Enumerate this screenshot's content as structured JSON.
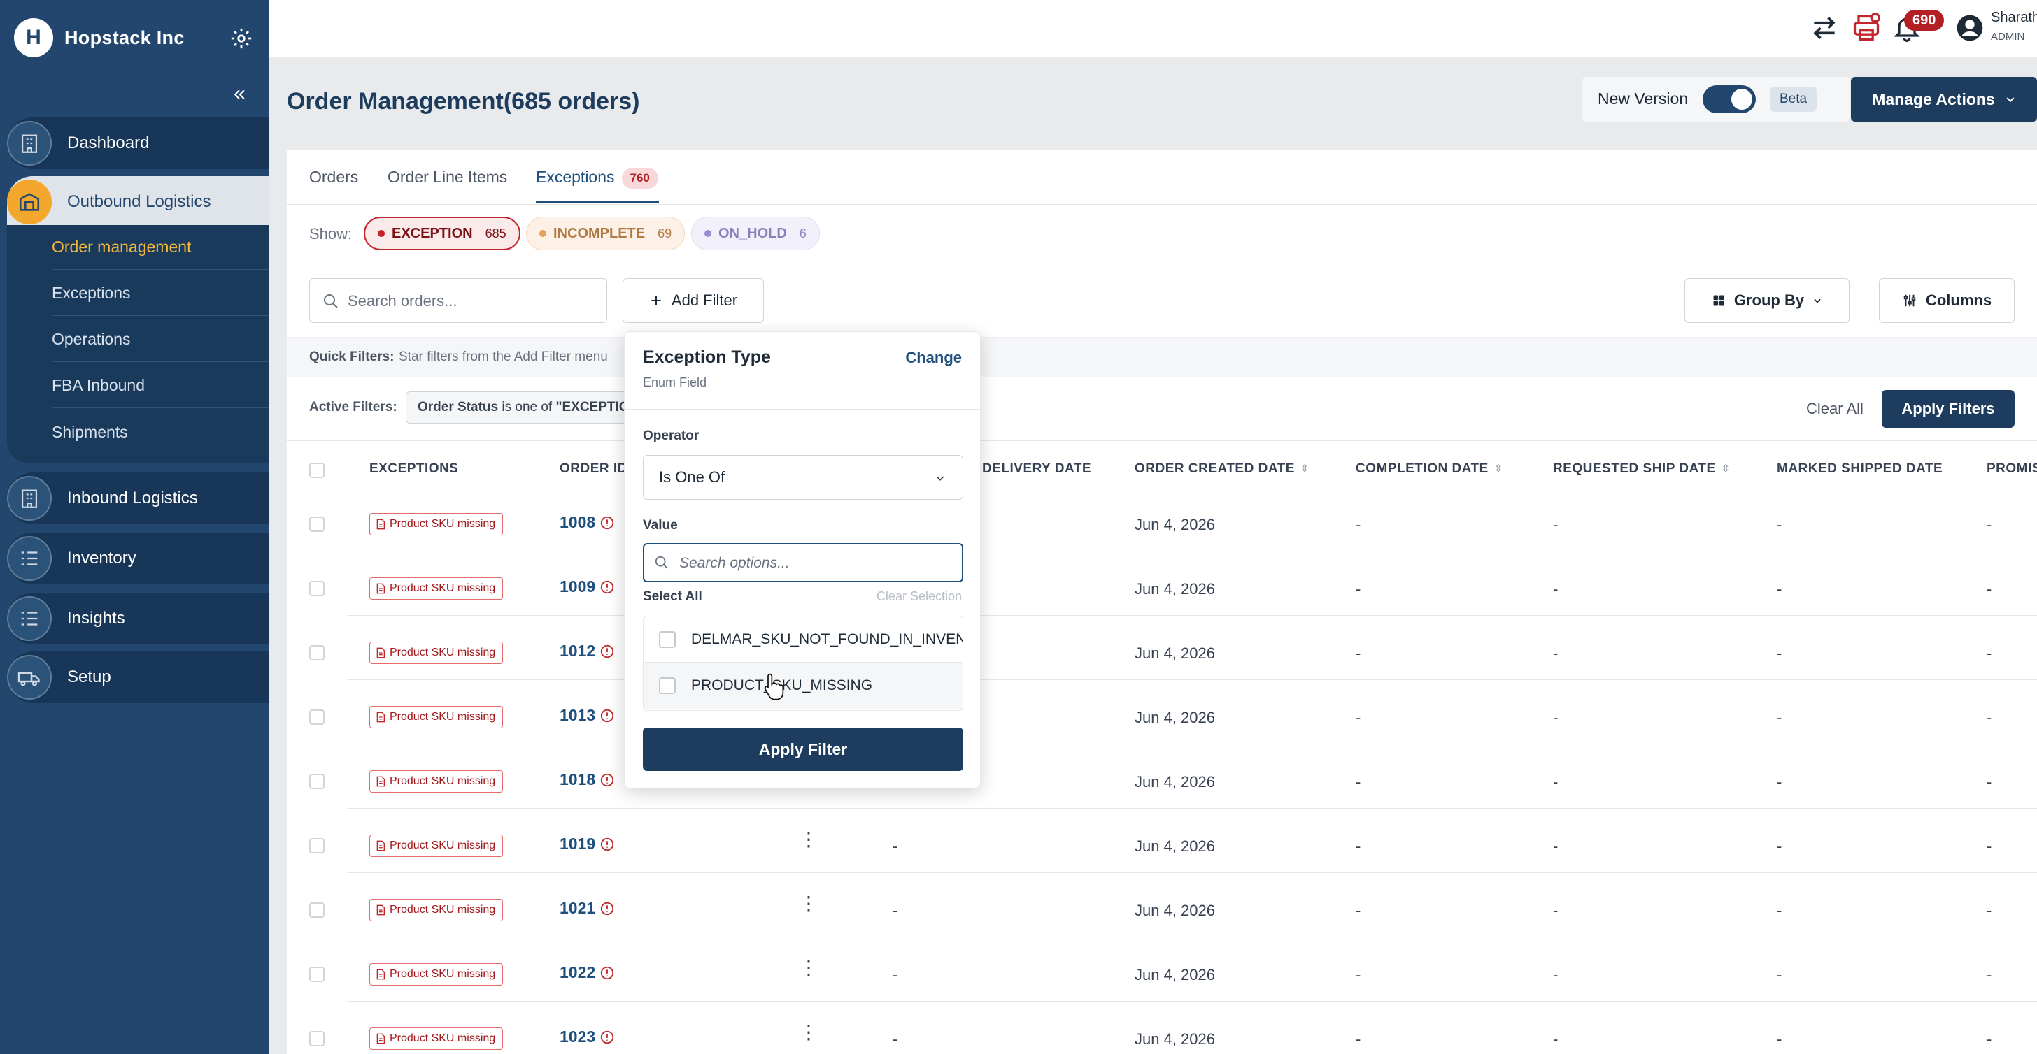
{
  "brand": {
    "name": "Hopstack Inc",
    "logo_letter": "H"
  },
  "sidebar": {
    "items": [
      {
        "label": "Dashboard",
        "icon": "building-icon"
      },
      {
        "label": "Outbound Logistics",
        "icon": "warehouse-icon"
      },
      {
        "label": "Inbound Logistics",
        "icon": "warehouse-icon"
      },
      {
        "label": "Inventory",
        "icon": "checklist-icon"
      },
      {
        "label": "Insights",
        "icon": "checklist-icon"
      },
      {
        "label": "Setup",
        "icon": "truck-icon"
      }
    ],
    "sub_items": [
      {
        "label": "Order management",
        "active": true
      },
      {
        "label": "Exceptions"
      },
      {
        "label": "Operations"
      },
      {
        "label": "FBA Inbound"
      },
      {
        "label": "Shipments"
      }
    ]
  },
  "topbar": {
    "notification_count": "690",
    "user_name": "Sharath",
    "user_role": "ADMIN"
  },
  "page": {
    "title": "Order Management(685 orders)",
    "new_version_label": "New Version",
    "beta_label": "Beta",
    "manage_actions_label": "Manage Actions"
  },
  "tabs": [
    {
      "label": "Orders"
    },
    {
      "label": "Order Line Items"
    },
    {
      "label": "Exceptions",
      "badge": "760",
      "active": true
    }
  ],
  "show": {
    "label": "Show:",
    "chips": [
      {
        "label": "EXCEPTION",
        "count": "685",
        "color": "#b21f24"
      },
      {
        "label": "INCOMPLETE",
        "count": "69",
        "color": "#e6a25a"
      },
      {
        "label": "ON_HOLD",
        "count": "6",
        "color": "#9b8bd0"
      }
    ]
  },
  "toolbar": {
    "search_placeholder": "Search orders...",
    "add_filter_label": "Add Filter",
    "group_by_label": "Group By",
    "columns_label": "Columns"
  },
  "quick_filters": {
    "label": "Quick Filters:",
    "text": "Star filters from the Add Filter menu"
  },
  "active_filters": {
    "label": "Active Filters:",
    "field": "Order Status",
    "op": "is one of",
    "value": "\"EXCEPTIO",
    "clear_all_label": "Clear All",
    "apply_filters_label": "Apply Filters"
  },
  "table": {
    "columns": [
      "EXCEPTIONS",
      "ORDER ID",
      "DELIVERY DATE",
      "ORDER CREATED DATE",
      "COMPLETION DATE",
      "REQUESTED SHIP DATE",
      "MARKED SHIPPED DATE",
      "PROMIS"
    ],
    "rows": [
      {
        "exception": "Product SKU missing",
        "order_id": "1008",
        "delivery": "",
        "created": "Jun 4, 2026",
        "completion": "-",
        "requested": "-",
        "shipped": "-",
        "promise": "-"
      },
      {
        "exception": "Product SKU missing",
        "order_id": "1009",
        "delivery": "",
        "created": "Jun 4, 2026",
        "completion": "-",
        "requested": "-",
        "shipped": "-",
        "promise": "-"
      },
      {
        "exception": "Product SKU missing",
        "order_id": "1012",
        "delivery": "",
        "created": "Jun 4, 2026",
        "completion": "-",
        "requested": "-",
        "shipped": "-",
        "promise": "-"
      },
      {
        "exception": "Product SKU missing",
        "order_id": "1013",
        "delivery": "",
        "created": "Jun 4, 2026",
        "completion": "-",
        "requested": "-",
        "shipped": "-",
        "promise": "-"
      },
      {
        "exception": "Product SKU missing",
        "order_id": "1018",
        "delivery": "",
        "created": "Jun 4, 2026",
        "completion": "-",
        "requested": "-",
        "shipped": "-",
        "promise": "-"
      },
      {
        "exception": "Product SKU missing",
        "order_id": "1019",
        "delivery": "-",
        "created": "Jun 4, 2026",
        "completion": "-",
        "requested": "-",
        "shipped": "-",
        "promise": "-"
      },
      {
        "exception": "Product SKU missing",
        "order_id": "1021",
        "delivery": "-",
        "created": "Jun 4, 2026",
        "completion": "-",
        "requested": "-",
        "shipped": "-",
        "promise": "-"
      },
      {
        "exception": "Product SKU missing",
        "order_id": "1022",
        "delivery": "-",
        "created": "Jun 4, 2026",
        "completion": "-",
        "requested": "-",
        "shipped": "-",
        "promise": "-"
      },
      {
        "exception": "Product SKU missing",
        "order_id": "1023",
        "delivery": "-",
        "created": "Jun 4, 2026",
        "completion": "-",
        "requested": "-",
        "shipped": "-",
        "promise": "-"
      }
    ]
  },
  "popover": {
    "title": "Exception Type",
    "change_label": "Change",
    "subtitle": "Enum Field",
    "operator_label": "Operator",
    "operator_value": "Is One Of",
    "value_label": "Value",
    "search_placeholder": "Search options...",
    "select_all_label": "Select All",
    "clear_selection_label": "Clear Selection",
    "options": [
      {
        "label": "DELMAR_SKU_NOT_FOUND_IN_INVEN"
      },
      {
        "label": "PRODUCT_SKU_MISSING"
      }
    ],
    "apply_label": "Apply Filter"
  }
}
